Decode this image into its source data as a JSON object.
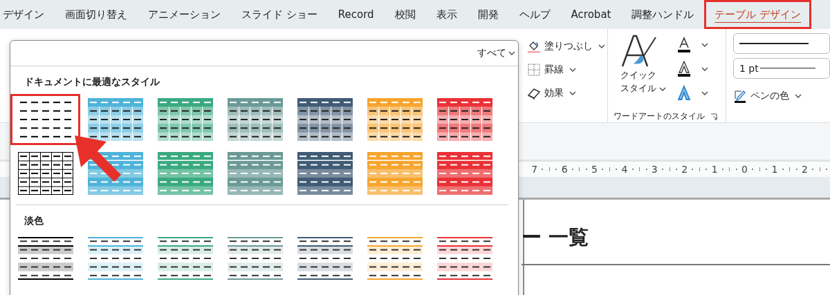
{
  "tabs": [
    {
      "label": "デザイン",
      "selected": false
    },
    {
      "label": "画面切り替え",
      "selected": false
    },
    {
      "label": "アニメーション",
      "selected": false
    },
    {
      "label": "スライド ショー",
      "selected": false
    },
    {
      "label": "Record",
      "selected": false
    },
    {
      "label": "校閲",
      "selected": false
    },
    {
      "label": "表示",
      "selected": false
    },
    {
      "label": "開発",
      "selected": false
    },
    {
      "label": "ヘルプ",
      "selected": false
    },
    {
      "label": "Acrobat",
      "selected": false
    },
    {
      "label": "調整ハンドル",
      "selected": false
    },
    {
      "label": "テーブル デザイン",
      "selected": true
    }
  ],
  "gallery": {
    "filter": "すべて",
    "sections": [
      {
        "title": "ドキュメントに最適なスタイル",
        "rows": [
          [
            {
              "kind": "plain",
              "color": "#000000",
              "selected": true
            },
            {
              "kind": "medium",
              "color": "#4fb3d9",
              "selected": false
            },
            {
              "kind": "medium",
              "color": "#3aa981",
              "selected": false
            },
            {
              "kind": "medium",
              "color": "#6b9a96",
              "selected": false
            },
            {
              "kind": "medium",
              "color": "#3f5b75",
              "selected": false
            },
            {
              "kind": "medium",
              "color": "#f6a52e",
              "selected": false
            },
            {
              "kind": "medium",
              "color": "#ea3136",
              "selected": false
            }
          ],
          [
            {
              "kind": "grid",
              "color": "#000000",
              "selected": false
            },
            {
              "kind": "banded",
              "color": "#4fb3d9",
              "selected": false
            },
            {
              "kind": "banded",
              "color": "#3aa981",
              "selected": false
            },
            {
              "kind": "banded",
              "color": "#6b9a96",
              "selected": false
            },
            {
              "kind": "banded",
              "color": "#3f5b75",
              "selected": false
            },
            {
              "kind": "banded",
              "color": "#f6a52e",
              "selected": false
            },
            {
              "kind": "banded",
              "color": "#ea3136",
              "selected": false
            }
          ]
        ]
      },
      {
        "title": "淡色",
        "rows": [
          [
            {
              "kind": "light",
              "color": "#000000",
              "selected": false
            },
            {
              "kind": "light",
              "color": "#4fb3d9",
              "selected": false
            },
            {
              "kind": "light",
              "color": "#3aa981",
              "selected": false
            },
            {
              "kind": "light",
              "color": "#6b9a96",
              "selected": false
            },
            {
              "kind": "light",
              "color": "#3f5b75",
              "selected": false
            },
            {
              "kind": "light",
              "color": "#f6a52e",
              "selected": false
            },
            {
              "kind": "light",
              "color": "#ea3136",
              "selected": false
            }
          ]
        ]
      }
    ]
  },
  "shading_group": {
    "items": [
      {
        "kind": "fill",
        "label": "塗りつぶし"
      },
      {
        "kind": "borders",
        "label": "罫線"
      },
      {
        "kind": "effects",
        "label": "効果"
      }
    ]
  },
  "wordart_group": {
    "quick_styles": "クイックスタイル",
    "label": "ワードアートのスタイル"
  },
  "borders_group": {
    "line_weight": "1 pt",
    "pen_color": "ペンの色"
  },
  "ruler": {
    "marks": [
      "7",
      "6",
      "5",
      "4",
      "3",
      "2",
      "1",
      "0",
      "1",
      "2"
    ]
  },
  "document": {
    "title": "ー 一覧"
  }
}
